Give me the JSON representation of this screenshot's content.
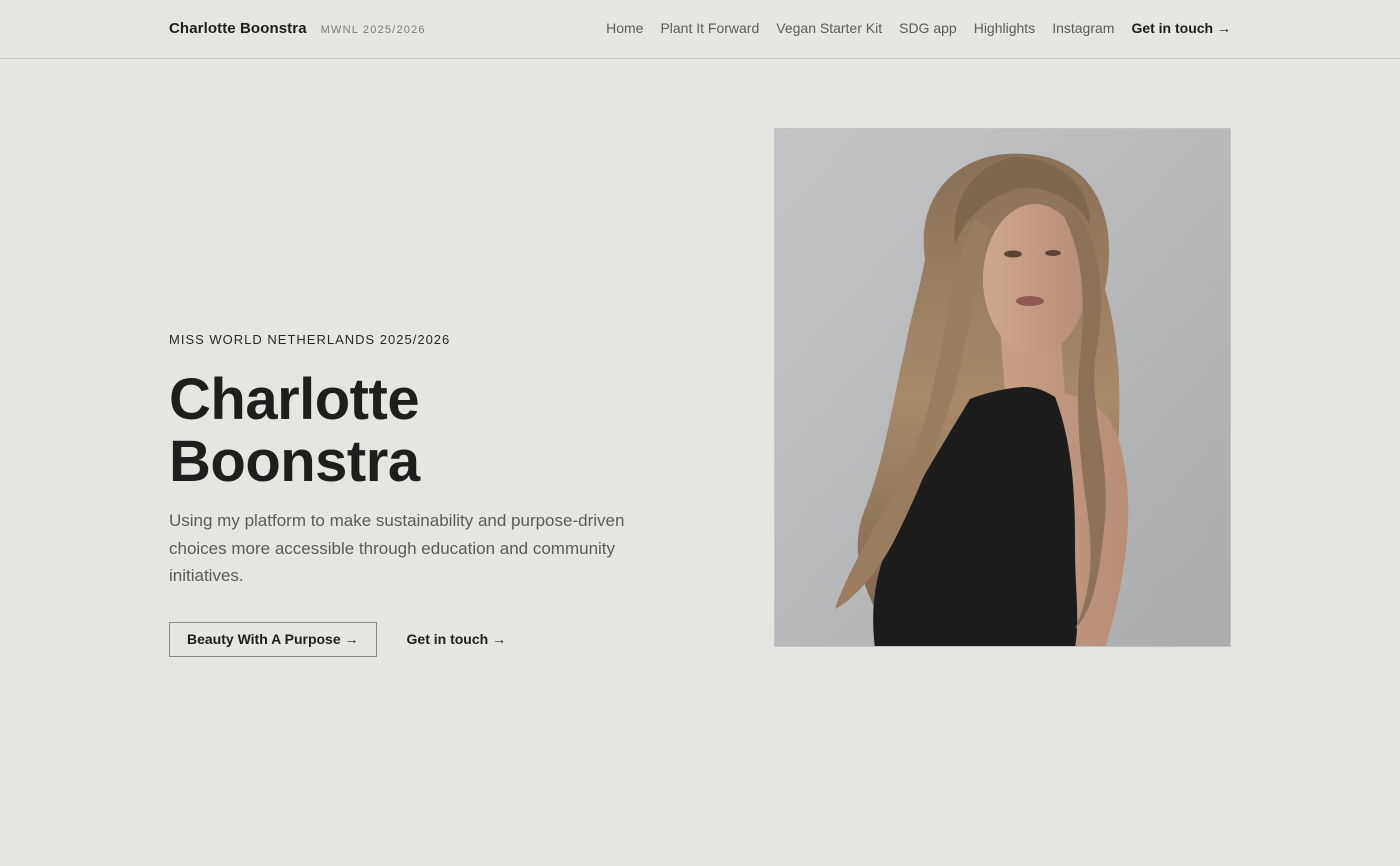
{
  "header": {
    "brand_name": "Charlotte Boonstra",
    "brand_sub": "MWNL 2025/2026",
    "nav": [
      {
        "label": "Home"
      },
      {
        "label": "Plant It Forward"
      },
      {
        "label": "Vegan Starter Kit"
      },
      {
        "label": "SDG app"
      },
      {
        "label": "Highlights"
      },
      {
        "label": "Instagram"
      },
      {
        "label": "Get in touch →"
      }
    ]
  },
  "hero": {
    "eyebrow": "MISS WORLD NETHERLANDS 2025/2026",
    "title": "Charlotte\nBoonstra",
    "description": "Using my platform to make sustainability and purpose-driven choices more accessible through education and community initiatives.",
    "primary_button": "Beauty With A Purpose →",
    "secondary_link": "Get in touch →"
  },
  "photo": {
    "icon": "portrait-photo"
  },
  "colors": {
    "background": "#e7e5e1",
    "text": "#1f1e1c",
    "muted": "#5d5b57",
    "border": "#8b8985"
  }
}
